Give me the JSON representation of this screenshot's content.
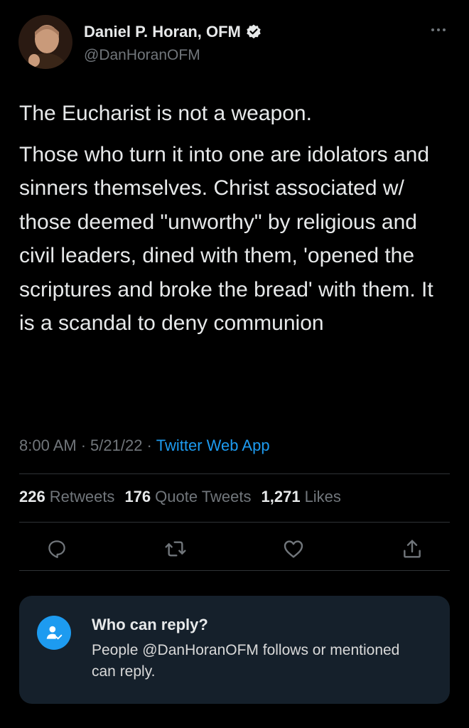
{
  "author": {
    "name": "Daniel P. Horan, OFM",
    "handle": "@DanHoranOFM",
    "verified": true,
    "avatar_icon": "profile-photo"
  },
  "tweet": {
    "paragraphs": [
      "The Eucharist is not a weapon.",
      "Those who turn it into one are idolators and sinners themselves. Christ associated w/ those deemed \"unworthy\" by religious and civil leaders, dined with them, 'opened the scriptures and broke the bread' with them. It is a scandal to deny communion"
    ],
    "time": "8:00 AM",
    "date": "5/21/22",
    "separator": "·",
    "source": "Twitter Web App"
  },
  "stats": {
    "retweets_count": "226",
    "retweets_label": "Retweets",
    "quotes_count": "176",
    "quotes_label": "Quote Tweets",
    "likes_count": "1,271",
    "likes_label": "Likes"
  },
  "actions": [
    "reply-icon",
    "retweet-icon",
    "like-icon",
    "share-icon"
  ],
  "reply_restriction": {
    "title": "Who can reply?",
    "body": "People @DanHoranOFM follows or mentioned can reply.",
    "icon": "user-check-icon"
  },
  "colors": {
    "background": "#000000",
    "text": "#e7e9ea",
    "muted": "#71767b",
    "accent": "#1d9bf0",
    "card": "#15202b"
  }
}
